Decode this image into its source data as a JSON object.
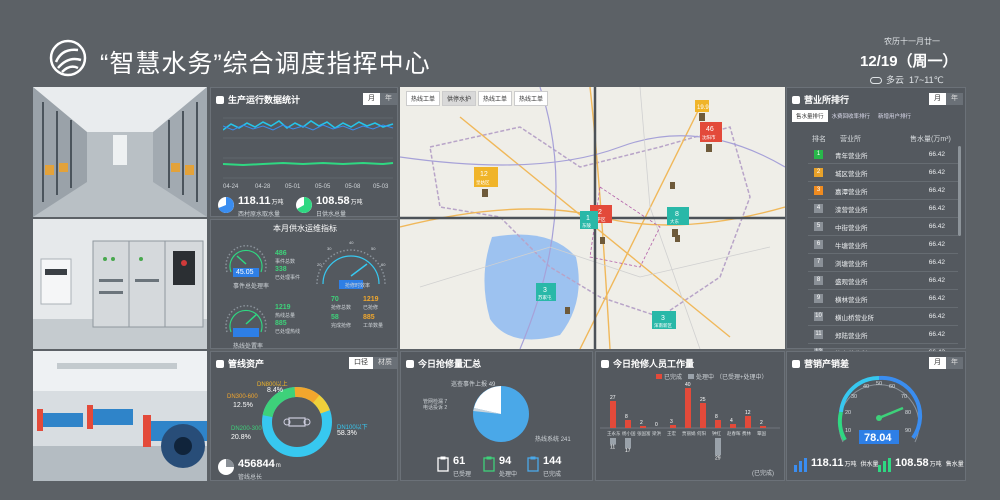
{
  "header": {
    "title": "“智慧水务”综合调度指挥中心",
    "lunar": "农历十一月廿一",
    "date": "12/19（周一）",
    "weather": "多云",
    "temp": "17~11℃"
  },
  "production": {
    "title": "生产运行数据统计",
    "toggle": [
      "月",
      "年"
    ],
    "xticks": [
      "04-24",
      "04-28",
      "05-01",
      "05-05",
      "05-08",
      "05-03"
    ],
    "stat1": {
      "value": "118.11",
      "unit": "万吨",
      "label": "西村原水取水量"
    },
    "stat2": {
      "value": "108.58",
      "unit": "万吨",
      "label": "日供水总量"
    },
    "colors": {
      "cyan": "#25c4e8",
      "green": "#2fd882",
      "blue": "#3a8df0"
    }
  },
  "supply": {
    "title": "本月供水运维指标",
    "g1": {
      "value": "45.05",
      "label": "事件总处理率"
    },
    "g2": {
      "value": "19.9",
      "label": "抢修时效率"
    },
    "g3": {
      "value": "78.04",
      "label": "热线处置率"
    },
    "s1": [
      {
        "value": "486",
        "label": "事件总数"
      },
      {
        "value": "338",
        "label": "已处理事件"
      }
    ],
    "s2": [
      {
        "value": "1219",
        "label": "热线总量"
      },
      {
        "value": "885",
        "label": "已处理热线"
      }
    ],
    "s3": [
      {
        "value": "70",
        "label": "抢修总数"
      },
      {
        "value": "1219",
        "label": "已抢修"
      },
      {
        "value": "58",
        "label": "完成抢修"
      },
      {
        "value": "885",
        "label": "工单数量"
      }
    ]
  },
  "map": {
    "tabs": [
      "热线工单",
      "供停水护",
      "热线工单",
      "热线工单"
    ],
    "markers": [
      {
        "count": "19.9",
        "name": ""
      },
      {
        "count": "46",
        "name": "沈阳市"
      },
      {
        "count": "12",
        "name": "皇姑区"
      },
      {
        "count": "2",
        "name": "和平区"
      },
      {
        "count": "1",
        "name": "东陵"
      },
      {
        "count": "8",
        "name": "大东"
      },
      {
        "count": "3",
        "name": "苏家屯"
      },
      {
        "count": "3",
        "name": "浑南新区"
      }
    ]
  },
  "ranking": {
    "title": "营业所排行",
    "toggle": [
      "月",
      "年"
    ],
    "tabs": [
      "售水量排行",
      "水费回收率排行",
      "新增用户排行"
    ],
    "headers": [
      "排名",
      "营业所",
      "售水量(万m³)"
    ],
    "rows": [
      {
        "rank": "1",
        "name": "青年营业所",
        "value": "66.42",
        "color": "#28b74a"
      },
      {
        "rank": "2",
        "name": "城区营业所",
        "value": "66.42",
        "color": "#e8a22a"
      },
      {
        "rank": "3",
        "name": "嘉潭营业所",
        "value": "66.42",
        "color": "#f08b1f"
      },
      {
        "rank": "4",
        "name": "滦营营业所",
        "value": "66.42",
        "color": "#8a9097"
      },
      {
        "rank": "5",
        "name": "中街营业所",
        "value": "66.42",
        "color": "#8a9097"
      },
      {
        "rank": "6",
        "name": "牛塘营业所",
        "value": "66.42",
        "color": "#8a9097"
      },
      {
        "rank": "7",
        "name": "浏塘营业所",
        "value": "66.42",
        "color": "#8a9097"
      },
      {
        "rank": "8",
        "name": "盛观营业所",
        "value": "66.42",
        "color": "#8a9097"
      },
      {
        "rank": "9",
        "name": "横林营业所",
        "value": "66.42",
        "color": "#8a9097"
      },
      {
        "rank": "10",
        "name": "横山桥营业所",
        "value": "66.42",
        "color": "#8a9097"
      },
      {
        "rank": "11",
        "name": "郑陆营业所",
        "value": "66.42",
        "color": "#8a9097"
      },
      {
        "rank": "12",
        "name": "礼嘉营业所",
        "value": "66.42",
        "color": "#8a9097"
      },
      {
        "rank": "13",
        "name": "洛阳营业所",
        "value": "66.42",
        "color": "#8a9097"
      }
    ]
  },
  "pipe": {
    "title": "管线资产",
    "toggle": [
      "口径",
      "材质"
    ],
    "segments": [
      {
        "label": "DN800以上",
        "pct": "8.4%",
        "color": "#f0b429"
      },
      {
        "label": "DN300-600",
        "pct": "12.5%",
        "color": "#f2a62d"
      },
      {
        "label": "DN200-300",
        "pct": "20.8%",
        "color": "#3ed17a"
      },
      {
        "label": "DN100以下",
        "pct": "58.3%",
        "color": "#37c8f0"
      }
    ],
    "total": {
      "value": "456844",
      "unit": "m",
      "label": "管线总长"
    }
  },
  "repair": {
    "title": "今日抢修量汇总",
    "slices": [
      {
        "label": "巡查事件上报",
        "value": "49"
      },
      {
        "label": "管网检漏",
        "value": "7"
      },
      {
        "label": "电话投诉",
        "value": "2"
      },
      {
        "label": "热线系统",
        "value": "241"
      }
    ],
    "kpis": [
      {
        "value": "61",
        "label": "已受理"
      },
      {
        "value": "94",
        "label": "处理中"
      },
      {
        "value": "144",
        "label": "已完成"
      }
    ]
  },
  "staff": {
    "title": "今日抢修人员工作量",
    "legend": "已完成",
    "legend2": "处理中",
    "legend_wrap": "（已受理+处理中）",
    "done_label": "已完成",
    "names": [
      "王永东",
      "杨小国",
      "张国富",
      "梁洪",
      "王宏",
      "贾丽娟",
      "何阳",
      "钟红",
      "赵春晖",
      "费林",
      "覃国"
    ],
    "done": [
      27,
      8,
      2,
      0,
      3,
      40,
      25,
      8,
      4,
      12,
      2
    ],
    "doing": [
      11,
      17,
      0,
      0,
      0,
      0,
      0,
      29,
      0,
      0,
      0
    ]
  },
  "sales": {
    "title": "营销产销差",
    "toggle": [
      "月",
      "年"
    ],
    "gauge": {
      "value": "78.04",
      "ticks": [
        "10",
        "20",
        "30",
        "40",
        "50",
        "60",
        "70",
        "80",
        "90"
      ]
    },
    "stat1": {
      "value": "118.11",
      "unit": "万吨",
      "label": "供水量"
    },
    "stat2": {
      "value": "108.58",
      "unit": "万吨",
      "label": "售水量"
    }
  }
}
